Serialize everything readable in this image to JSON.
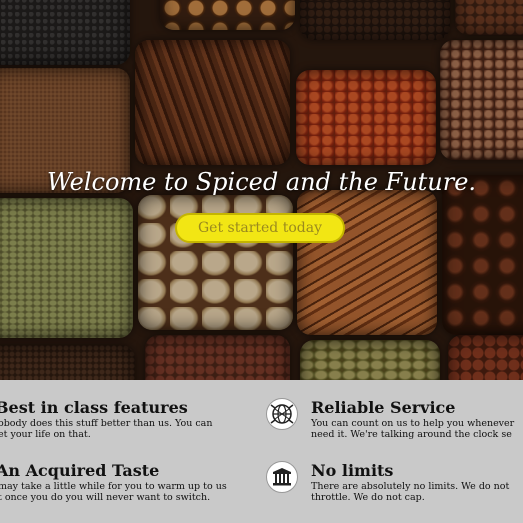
{
  "hero": {
    "title": "Welcome to Spiced and the Future.",
    "cta_label": "Get started today"
  },
  "features": [
    {
      "title": "Best in class features",
      "desc_line1": "obody does this stuff better than us. You can",
      "desc_line2": "et your life on that.",
      "icon": null
    },
    {
      "title": "Reliable Service",
      "desc_line1": "You can count on us to help you whenever",
      "desc_line2": "need it. We're talking around the clock se",
      "icon": "globe-icon"
    },
    {
      "title": "An Acquired Taste",
      "desc_line1": "may take a little while for you to warm up to us",
      "desc_line2": "t once you do you will never want to switch.",
      "icon": null
    },
    {
      "title": "No limits",
      "desc_line1": "There are absolutely no limits. We do not",
      "desc_line2": "throttle. We do not cap.",
      "icon": "bank-icon"
    }
  ],
  "colors": {
    "cta_fill": "#f2e614",
    "cta_text": "#9a8a1e",
    "features_bg": "#c9c9c9"
  }
}
